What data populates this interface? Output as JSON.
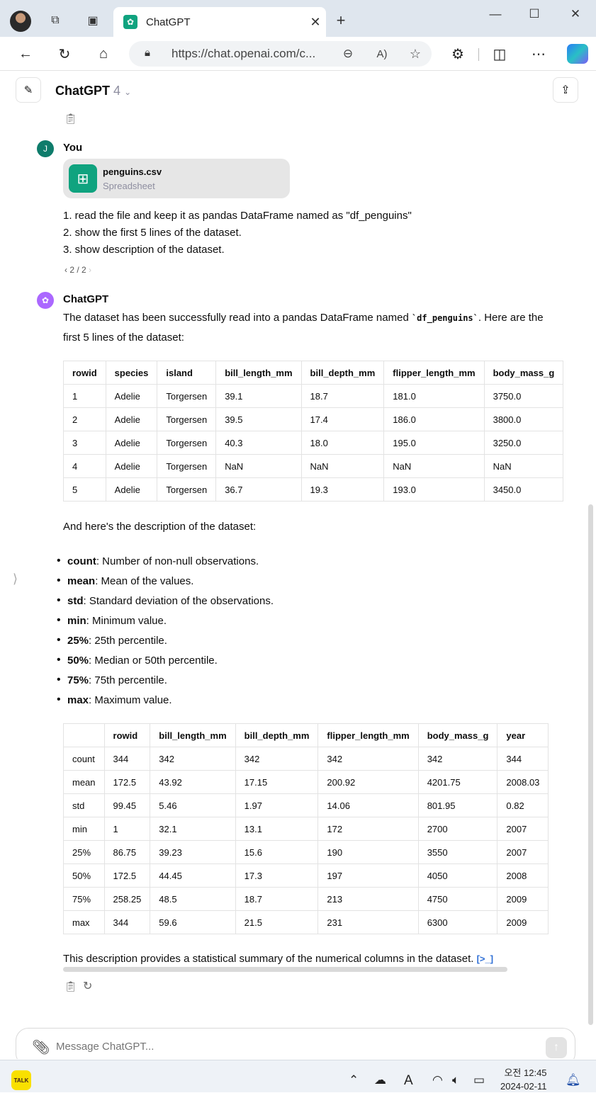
{
  "browser": {
    "tab_title": "ChatGPT",
    "url": "https://chat.openai.com/c...",
    "icons": [
      "back-icon",
      "refresh-icon",
      "home-icon",
      "lock-icon",
      "zoom-icon",
      "read-aloud-icon",
      "favorite-icon",
      "extensions-icon",
      "split-screen-icon",
      "more-icon",
      "copilot-icon"
    ]
  },
  "chat": {
    "model_name": "ChatGPT",
    "model_version": "4",
    "user": {
      "avatar_letter": "J",
      "name": "You",
      "file_name": "penguins.csv",
      "file_type": "Spreadsheet",
      "lines": [
        "1. read the file and keep it as pandas DataFrame named as \"df_penguins\"",
        "2. show the first 5 lines of the dataset.",
        "3. show description of the dataset."
      ],
      "pager": "2 / 2"
    },
    "assistant": {
      "name": "ChatGPT",
      "intro_before": "The dataset has been successfully read into a pandas DataFrame named ",
      "intro_code": "`df_penguins`",
      "intro_after": ". Here are the",
      "intro_line2": "first 5 lines of the dataset:",
      "head_table": {
        "columns": [
          "rowid",
          "species",
          "island",
          "bill_length_mm",
          "bill_depth_mm",
          "flipper_length_mm",
          "body_mass_g"
        ],
        "rows": [
          [
            "1",
            "Adelie",
            "Torgersen",
            "39.1",
            "18.7",
            "181.0",
            "3750.0"
          ],
          [
            "2",
            "Adelie",
            "Torgersen",
            "39.5",
            "17.4",
            "186.0",
            "3800.0"
          ],
          [
            "3",
            "Adelie",
            "Torgersen",
            "40.3",
            "18.0",
            "195.0",
            "3250.0"
          ],
          [
            "4",
            "Adelie",
            "Torgersen",
            "NaN",
            "NaN",
            "NaN",
            "NaN"
          ],
          [
            "5",
            "Adelie",
            "Torgersen",
            "36.7",
            "19.3",
            "193.0",
            "3450.0"
          ]
        ]
      },
      "description_intro": "And here's the description of the dataset:",
      "bullets": [
        {
          "term": "count",
          "text": ": Number of non-null observations."
        },
        {
          "term": "mean",
          "text": ": Mean of the values."
        },
        {
          "term": "std",
          "text": ": Standard deviation of the observations."
        },
        {
          "term": "min",
          "text": ": Minimum value."
        },
        {
          "term": "25%",
          "text": ": 25th percentile."
        },
        {
          "term": "50%",
          "text": ": Median or 50th percentile."
        },
        {
          "term": "75%",
          "text": ": 75th percentile."
        },
        {
          "term": "max",
          "text": ": Maximum value."
        }
      ],
      "describe_table": {
        "columns": [
          "",
          "rowid",
          "bill_length_mm",
          "bill_depth_mm",
          "flipper_length_mm",
          "body_mass_g",
          "year"
        ],
        "rows": [
          [
            "count",
            "344",
            "342",
            "342",
            "342",
            "342",
            "344"
          ],
          [
            "mean",
            "172.5",
            "43.92",
            "17.15",
            "200.92",
            "4201.75",
            "2008.03"
          ],
          [
            "std",
            "99.45",
            "5.46",
            "1.97",
            "14.06",
            "801.95",
            "0.82"
          ],
          [
            "min",
            "1",
            "32.1",
            "13.1",
            "172",
            "2700",
            "2007"
          ],
          [
            "25%",
            "86.75",
            "39.23",
            "15.6",
            "190",
            "3550",
            "2007"
          ],
          [
            "50%",
            "172.5",
            "44.45",
            "17.3",
            "197",
            "4050",
            "2008"
          ],
          [
            "75%",
            "258.25",
            "48.5",
            "18.7",
            "213",
            "4750",
            "2009"
          ],
          [
            "max",
            "344",
            "59.6",
            "21.5",
            "231",
            "6300",
            "2009"
          ]
        ]
      },
      "closing": "This description provides a statistical summary of the numerical columns in the dataset.",
      "code_link_glyph": "[>_]"
    }
  },
  "composer": {
    "placeholder": "Message ChatGPT..."
  },
  "taskbar": {
    "kakao_label": "TALK",
    "ime": "A",
    "time": "오전 12:45",
    "date": "2024-02-11"
  },
  "colors": {
    "accent_green": "#10a37f",
    "chatgpt_purple": "#ab68ff",
    "user_avatar": "#0e7c6b"
  }
}
